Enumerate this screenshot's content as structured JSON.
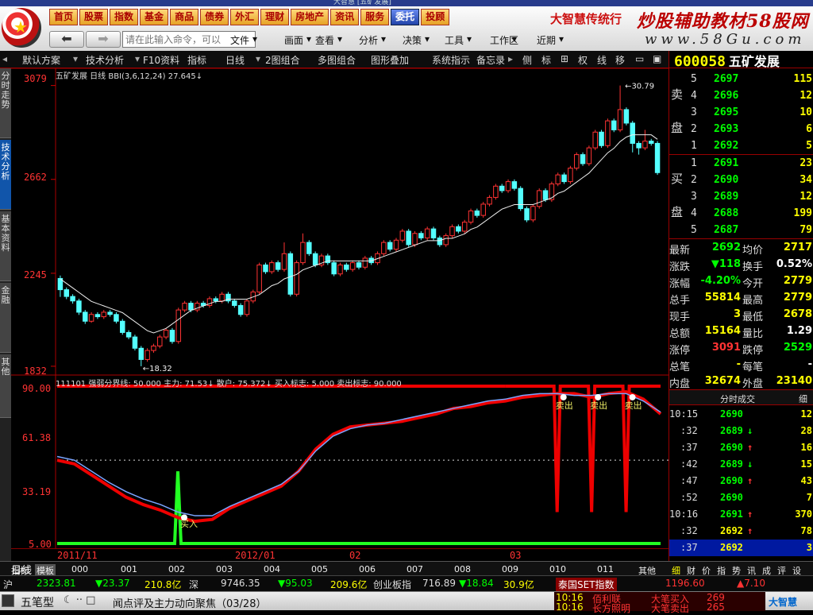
{
  "window": {
    "title": "大智慧 [五矿发展]"
  },
  "quick_tabs": [
    {
      "label": "首页"
    },
    {
      "label": "股票"
    },
    {
      "label": "指数"
    },
    {
      "label": "基金"
    },
    {
      "label": "商品"
    },
    {
      "label": "债券"
    },
    {
      "label": "外汇"
    },
    {
      "label": "理财"
    },
    {
      "label": "房地产"
    },
    {
      "label": "资讯"
    },
    {
      "label": "服务"
    },
    {
      "label": "委托",
      "active": true
    },
    {
      "label": "投顾"
    }
  ],
  "brand": {
    "product": "大智慧传统行",
    "watermark": "炒股辅助教材58股网",
    "watermark_url": "www.58Gu.com"
  },
  "command_box": {
    "placeholder": "请在此输入命令，可以"
  },
  "menus": [
    "文件",
    "画面",
    "查看",
    "分析",
    "决策",
    "工具",
    "工作区",
    "近期"
  ],
  "toolbar": {
    "items": [
      "默认方案",
      "技术分析",
      "F10资料",
      "指标",
      "日线",
      "2图组合",
      "多图组合",
      "图形叠加",
      "系统指示",
      "备忘录",
      "侧",
      "标",
      "权",
      "线",
      "移"
    ]
  },
  "sidebar_tabs": [
    "分时走势",
    "技术分析",
    "基本资料",
    "金融",
    "其他"
  ],
  "main_chart": {
    "info": "五矿发展 日线 BBI(3,6,12,24)  27.645↓",
    "price_labels": [
      "3079",
      "2662",
      "2245",
      "1832"
    ],
    "annotations": [
      "30.79",
      "18.32"
    ]
  },
  "indicator": {
    "info": "111101 强弱分界线: 50.000  主力: 71.53↓  散户: 75.372↓  买入标志: 5.000  卖出标志: 90.000",
    "labels": [
      "90.00",
      "61.38",
      "33.19",
      "5.00"
    ],
    "buy_label": "买入",
    "sell_label": "卖出"
  },
  "date_axis": {
    "labels": [
      "2011/11",
      "2012/01",
      "02",
      "03"
    ]
  },
  "chart_data": {
    "type": "candlestick",
    "title": "五矿发展 日线",
    "ylabel": "",
    "yticks": [
      30.79,
      26.62,
      22.45,
      18.32
    ],
    "ylim": [
      18.0,
      31.2
    ],
    "candles": [
      [
        22.22,
        21.72,
        22.35,
        21.4
      ],
      [
        21.72,
        21.42,
        21.82,
        21.3
      ],
      [
        21.42,
        21.22,
        21.52,
        21.1
      ],
      [
        21.22,
        20.72,
        21.32,
        20.6
      ],
      [
        20.72,
        20.32,
        20.82,
        20.2
      ],
      [
        20.32,
        20.62,
        20.72,
        20.25
      ],
      [
        20.62,
        20.52,
        20.72,
        20.42
      ],
      [
        20.52,
        20.72,
        20.82,
        20.42
      ],
      [
        20.72,
        20.62,
        20.82,
        20.52
      ],
      [
        20.62,
        20.32,
        20.72,
        20.22
      ],
      [
        20.32,
        19.82,
        20.42,
        19.72
      ],
      [
        19.82,
        19.62,
        19.92,
        19.52
      ],
      [
        19.62,
        19.12,
        19.72,
        19.02
      ],
      [
        19.12,
        18.62,
        19.22,
        18.32
      ],
      [
        18.62,
        19.02,
        19.12,
        18.52
      ],
      [
        19.02,
        19.22,
        19.32,
        18.92
      ],
      [
        19.22,
        19.62,
        19.72,
        19.12
      ],
      [
        19.62,
        19.92,
        20.02,
        19.52
      ],
      [
        19.92,
        19.42,
        20.02,
        19.32
      ],
      [
        19.42,
        20.82,
        20.92,
        19.32
      ],
      [
        20.82,
        21.12,
        21.22,
        20.72
      ],
      [
        21.12,
        20.82,
        21.22,
        20.72
      ],
      [
        20.82,
        21.12,
        21.22,
        20.72
      ],
      [
        21.12,
        21.02,
        21.22,
        20.92
      ],
      [
        21.02,
        21.32,
        21.42,
        20.92
      ],
      [
        21.32,
        21.22,
        21.42,
        21.12
      ],
      [
        21.22,
        21.52,
        21.62,
        21.12
      ],
      [
        21.52,
        21.22,
        21.62,
        21.12
      ],
      [
        21.22,
        21.02,
        21.32,
        20.92
      ],
      [
        21.02,
        20.62,
        21.12,
        20.52
      ],
      [
        20.62,
        21.22,
        21.32,
        20.52
      ],
      [
        21.22,
        21.62,
        21.72,
        21.12
      ],
      [
        21.62,
        22.82,
        22.92,
        21.52
      ],
      [
        22.82,
        22.52,
        22.92,
        22.42
      ],
      [
        22.52,
        22.92,
        23.02,
        22.42
      ],
      [
        22.92,
        22.62,
        23.02,
        22.52
      ],
      [
        22.62,
        23.32,
        23.82,
        22.52
      ],
      [
        23.32,
        21.52,
        23.42,
        21.42
      ],
      [
        21.52,
        22.92,
        23.02,
        21.42
      ],
      [
        22.92,
        23.82,
        24.22,
        22.82
      ],
      [
        23.82,
        23.32,
        23.92,
        23.22
      ],
      [
        23.32,
        22.82,
        23.42,
        22.72
      ],
      [
        22.82,
        23.22,
        23.32,
        22.72
      ],
      [
        23.22,
        22.92,
        23.32,
        22.82
      ],
      [
        22.92,
        22.42,
        23.02,
        22.32
      ],
      [
        22.42,
        22.82,
        22.92,
        22.32
      ],
      [
        22.82,
        22.62,
        22.92,
        22.52
      ],
      [
        22.62,
        22.92,
        23.02,
        22.52
      ],
      [
        22.92,
        22.72,
        23.02,
        22.62
      ],
      [
        22.72,
        23.12,
        23.22,
        22.62
      ],
      [
        23.12,
        22.92,
        23.22,
        22.82
      ],
      [
        22.92,
        23.32,
        23.42,
        22.82
      ],
      [
        23.32,
        23.82,
        23.92,
        23.22
      ],
      [
        23.82,
        23.52,
        23.92,
        23.42
      ],
      [
        23.52,
        23.92,
        24.02,
        23.42
      ],
      [
        23.92,
        24.32,
        24.42,
        23.82
      ],
      [
        24.32,
        23.72,
        24.42,
        23.62
      ],
      [
        23.72,
        24.22,
        24.32,
        23.62
      ],
      [
        24.22,
        24.02,
        24.32,
        23.92
      ],
      [
        24.02,
        24.42,
        24.52,
        23.92
      ],
      [
        24.42,
        24.02,
        24.52,
        23.92
      ],
      [
        24.02,
        23.72,
        24.12,
        23.62
      ],
      [
        23.72,
        24.12,
        24.22,
        23.62
      ],
      [
        24.12,
        24.52,
        24.62,
        24.02
      ],
      [
        24.52,
        24.32,
        24.62,
        24.22
      ],
      [
        24.32,
        24.72,
        24.82,
        24.22
      ],
      [
        24.72,
        25.22,
        25.32,
        24.62
      ],
      [
        25.22,
        25.02,
        25.32,
        24.92
      ],
      [
        25.02,
        25.52,
        25.62,
        24.92
      ],
      [
        25.52,
        25.82,
        25.92,
        25.42
      ],
      [
        25.82,
        26.32,
        26.42,
        25.72
      ],
      [
        26.32,
        26.12,
        26.42,
        26.02
      ],
      [
        26.12,
        26.52,
        26.62,
        26.02
      ],
      [
        26.52,
        26.22,
        26.62,
        26.12
      ],
      [
        26.22,
        25.32,
        26.32,
        25.22
      ],
      [
        25.32,
        24.82,
        25.42,
        24.72
      ],
      [
        24.82,
        25.42,
        25.52,
        24.72
      ],
      [
        25.42,
        26.12,
        26.22,
        25.32
      ],
      [
        26.12,
        25.72,
        26.22,
        25.62
      ],
      [
        25.72,
        26.42,
        26.52,
        25.62
      ],
      [
        26.42,
        26.82,
        26.92,
        26.32
      ],
      [
        26.82,
        26.52,
        26.92,
        26.42
      ],
      [
        26.52,
        27.12,
        27.22,
        26.42
      ],
      [
        27.12,
        27.72,
        27.82,
        27.02
      ],
      [
        27.72,
        27.32,
        27.82,
        27.22
      ],
      [
        27.32,
        28.02,
        28.12,
        27.22
      ],
      [
        28.02,
        28.72,
        28.82,
        27.92
      ],
      [
        28.72,
        28.12,
        28.82,
        28.02
      ],
      [
        28.12,
        29.22,
        29.32,
        28.02
      ],
      [
        29.22,
        28.82,
        29.32,
        28.72
      ],
      [
        28.82,
        29.72,
        30.79,
        28.72
      ],
      [
        29.72,
        29.12,
        29.82,
        29.02
      ],
      [
        29.12,
        28.22,
        29.22,
        27.82
      ],
      [
        28.22,
        28.02,
        28.32,
        27.72
      ],
      [
        28.02,
        28.32,
        28.82,
        27.92
      ],
      [
        28.32,
        28.22,
        28.42,
        28.12
      ],
      [
        28.22,
        26.92,
        28.32,
        26.82
      ]
    ],
    "bbi": [
      22.2,
      22.0,
      21.8,
      21.6,
      21.4,
      21.2,
      21.1,
      21.0,
      20.9,
      20.8,
      20.7,
      20.5,
      20.3,
      20.1,
      19.9,
      19.8,
      19.9,
      20.0,
      20.2,
      20.4,
      20.6,
      20.8,
      20.9,
      21.0,
      21.1,
      21.2,
      21.2,
      21.3,
      21.3,
      21.3,
      21.3,
      21.4,
      21.5,
      21.7,
      21.9,
      22.0,
      22.2,
      22.3,
      22.4,
      22.6,
      22.7,
      22.8,
      22.9,
      23.0,
      23.0,
      23.0,
      23.0,
      23.0,
      23.0,
      23.0,
      23.0,
      23.1,
      23.2,
      23.3,
      23.4,
      23.5,
      23.6,
      23.7,
      23.8,
      23.9,
      23.9,
      23.9,
      24.0,
      24.0,
      24.1,
      24.2,
      24.4,
      24.5,
      24.7,
      24.9,
      25.1,
      25.3,
      25.4,
      25.5,
      25.5,
      25.5,
      25.5,
      25.6,
      25.7,
      25.8,
      26.0,
      26.1,
      26.3,
      26.5,
      26.7,
      26.9,
      27.2,
      27.5,
      27.8,
      28.0,
      28.3,
      28.5,
      28.6,
      28.6,
      28.6,
      28.6,
      28.4
    ],
    "indicator_series": [
      {
        "name": "主力",
        "values": [
          50,
          48,
          42,
          36,
          30,
          26,
          23,
          19,
          17,
          18,
          24,
          28,
          32,
          36,
          44,
          56,
          64,
          68,
          69,
          70,
          71,
          73,
          75,
          78,
          79,
          81,
          82,
          84,
          85,
          86,
          86,
          84,
          86,
          87,
          83,
          75
        ]
      },
      {
        "name": "散户",
        "values": [
          52,
          50,
          44,
          38,
          33,
          29,
          26,
          22,
          20,
          20,
          25,
          29,
          33,
          37,
          44,
          55,
          63,
          67,
          69,
          70,
          72,
          74,
          76,
          78,
          80,
          82,
          83,
          85,
          86,
          86,
          85,
          85,
          86,
          86,
          82,
          76
        ]
      }
    ],
    "sell_signal_x": [
      29,
      31,
      33
    ],
    "buy_signal_x": [
      7
    ],
    "ind_ylim": [
      5,
      90
    ]
  },
  "quote": {
    "code": "600058",
    "name": "五矿发展",
    "sell_label": [
      "卖",
      "盘"
    ],
    "buy_label": [
      "买",
      "盘"
    ],
    "asks": [
      {
        "lvl": "5",
        "price": "2697",
        "vol": "115"
      },
      {
        "lvl": "4",
        "price": "2696",
        "vol": "12"
      },
      {
        "lvl": "3",
        "price": "2695",
        "vol": "10"
      },
      {
        "lvl": "2",
        "price": "2693",
        "vol": "6"
      },
      {
        "lvl": "1",
        "price": "2692",
        "vol": "5"
      }
    ],
    "bids": [
      {
        "lvl": "1",
        "price": "2691",
        "vol": "23"
      },
      {
        "lvl": "2",
        "price": "2690",
        "vol": "34"
      },
      {
        "lvl": "3",
        "price": "2689",
        "vol": "12"
      },
      {
        "lvl": "4",
        "price": "2688",
        "vol": "199"
      },
      {
        "lvl": "5",
        "price": "2687",
        "vol": "79"
      }
    ],
    "stats": [
      {
        "l": "最新",
        "v": "2692",
        "vc": "#0f0",
        "l2": "均价",
        "v2": "2717",
        "v2c": "#ff0"
      },
      {
        "l": "涨跌",
        "v": "▼118",
        "vc": "#0f0",
        "l2": "换手",
        "v2": "0.52%",
        "v2c": "#fff"
      },
      {
        "l": "涨幅",
        "v": "-4.20%",
        "vc": "#0f0",
        "l2": "今开",
        "v2": "2779",
        "v2c": "#ff0"
      },
      {
        "l": "总手",
        "v": "55814",
        "vc": "#ff0",
        "l2": "最高",
        "v2": "2779",
        "v2c": "#ff0"
      },
      {
        "l": "现手",
        "v": "3",
        "vc": "#ff0",
        "l2": "最低",
        "v2": "2678",
        "v2c": "#ff0"
      },
      {
        "l": "总额",
        "v": "15164",
        "vc": "#ff0",
        "l2": "量比",
        "v2": "1.29",
        "v2c": "#fff"
      },
      {
        "l": "涨停",
        "v": "3091",
        "vc": "#f33",
        "l2": "跌停",
        "v2": "2529",
        "v2c": "#0f0"
      },
      {
        "l": "总笔",
        "v": "-",
        "vc": "#ff0",
        "l2": "每笔",
        "v2": "-",
        "v2c": "#fff"
      },
      {
        "l": "内盘",
        "v": "32674",
        "vc": "#ff0",
        "l2": "外盘",
        "v2": "23140",
        "v2c": "#ff0"
      }
    ],
    "ticks_header": "分时成交",
    "ticks_header2": "细",
    "ticks": [
      {
        "t": "10:15",
        "p": "2690",
        "arrow": "",
        "v": "12"
      },
      {
        "t": ":32",
        "p": "2689",
        "arrow": "↓",
        "v": "28"
      },
      {
        "t": ":37",
        "p": "2690",
        "arrow": "↑",
        "v": "16"
      },
      {
        "t": ":42",
        "p": "2689",
        "arrow": "↓",
        "v": "15"
      },
      {
        "t": ":47",
        "p": "2690",
        "arrow": "↑",
        "v": "43"
      },
      {
        "t": ":52",
        "p": "2690",
        "arrow": "",
        "v": "7"
      },
      {
        "t": "10:16",
        "p": "2691",
        "arrow": "↑",
        "v": "370"
      },
      {
        "t": ":32",
        "p": "2692",
        "arrow": "↑",
        "v": "78"
      },
      {
        "t": ":37",
        "p": "2692",
        "arrow": "",
        "v": "3"
      }
    ]
  },
  "bottom_tabs": {
    "left": [
      "日线"
    ],
    "labels": [
      "指标",
      "模板",
      "000",
      "001",
      "002",
      "003",
      "004",
      "005",
      "006",
      "007",
      "008",
      "009",
      "010",
      "011",
      "其他"
    ],
    "right": [
      "细",
      "财",
      "价",
      "指",
      "势",
      "讯",
      "成",
      "评",
      "设"
    ]
  },
  "index_bar": [
    {
      "text": "沪",
      "c": "#ddd"
    },
    {
      "text": "2323.81",
      "c": "#0f0"
    },
    {
      "text": "▼23.37",
      "c": "#0f0"
    },
    {
      "text": "210.8亿",
      "c": "#ff0"
    },
    {
      "text": "深",
      "c": "#ddd"
    },
    {
      "text": "9746.35",
      "c": "#ddd"
    },
    {
      "text": "▼95.03",
      "c": "#0f0"
    },
    {
      "text": "209.6亿",
      "c": "#ff0"
    },
    {
      "text": "创业板指",
      "c": "#ddd"
    },
    {
      "text": "716.89",
      "c": "#ddd"
    },
    {
      "text": "▼18.84",
      "c": "#0f0"
    },
    {
      "text": "30.9亿",
      "c": "#ff0"
    },
    {
      "text": "泰国SET指数",
      "c": "#fff"
    },
    {
      "text": "1196.60",
      "c": "#f33"
    },
    {
      "text": "▲7.10",
      "c": "#f33"
    }
  ],
  "status": {
    "layout_name": "五笔型",
    "news": "闻点评及主力动向聚焦（03/28）",
    "alerts": [
      {
        "t": "10:16",
        "name": "佰利联",
        "txt": "大笔买入",
        "vol": "269"
      },
      {
        "t": "10:16",
        "name": "长方照明",
        "txt": "大笔卖出",
        "vol": "265"
      }
    ],
    "logo": "大智慧"
  }
}
